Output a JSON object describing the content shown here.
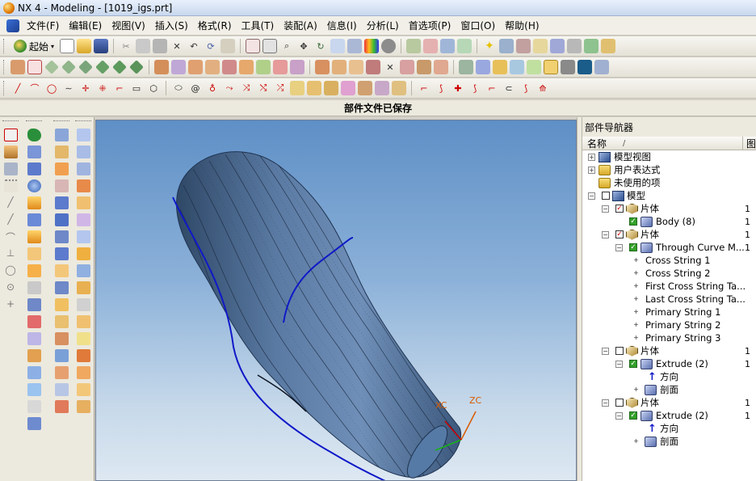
{
  "window": {
    "title": "NX 4 - Modeling - [1019_igs.prt]"
  },
  "menu": {
    "items": [
      "文件(F)",
      "编辑(E)",
      "视图(V)",
      "插入(S)",
      "格式(R)",
      "工具(T)",
      "装配(A)",
      "信息(I)",
      "分析(L)",
      "首选项(P)",
      "窗口(O)",
      "帮助(H)"
    ]
  },
  "toolbar": {
    "start_label": "起始",
    "status_message": "部件文件已保存"
  },
  "navigator": {
    "title": "部件导航器",
    "columns": {
      "name": "名称",
      "sort_indicator": "/",
      "image": "图"
    },
    "rows": [
      {
        "label": "模型视图",
        "expander": "+",
        "icon": "model-view-icon",
        "count": ""
      },
      {
        "label": "用户表达式",
        "expander": "+",
        "icon": "folder-icon",
        "count": ""
      },
      {
        "label": "未使用的项",
        "expander": "",
        "icon": "folder-icon",
        "count": ""
      },
      {
        "label": "模型",
        "expander": "−",
        "icon": "model-icon",
        "count": ""
      },
      {
        "label": "片体",
        "expander": "−",
        "icon": "sheet-body-icon",
        "count": "1"
      },
      {
        "label": "Body (8)",
        "expander": "",
        "icon": "body-feature-icon",
        "count": "1"
      },
      {
        "label": "片体",
        "expander": "−",
        "icon": "sheet-body-icon",
        "count": "1"
      },
      {
        "label": "Through Curve M...",
        "expander": "−",
        "icon": "through-curve-icon",
        "count": "1"
      },
      {
        "label": "Cross String 1",
        "expander": "+",
        "icon": "",
        "count": ""
      },
      {
        "label": "Cross String 2",
        "expander": "+",
        "icon": "",
        "count": ""
      },
      {
        "label": "First Cross String Ta...",
        "expander": "+",
        "icon": "",
        "count": ""
      },
      {
        "label": "Last Cross String Ta...",
        "expander": "+",
        "icon": "",
        "count": ""
      },
      {
        "label": "Primary String 1",
        "expander": "+",
        "icon": "",
        "count": ""
      },
      {
        "label": "Primary String 2",
        "expander": "+",
        "icon": "",
        "count": ""
      },
      {
        "label": "Primary String 3",
        "expander": "+",
        "icon": "",
        "count": ""
      },
      {
        "label": "片体",
        "expander": "−",
        "icon": "sheet-body-icon",
        "count": "1"
      },
      {
        "label": "Extrude (2)",
        "expander": "−",
        "icon": "extrude-icon",
        "count": "1"
      },
      {
        "label": "方向",
        "expander": "",
        "icon": "direction-arrow-icon",
        "count": ""
      },
      {
        "label": "剖面",
        "expander": "+",
        "icon": "section-icon",
        "count": ""
      },
      {
        "label": "片体",
        "expander": "−",
        "icon": "sheet-body-icon",
        "count": "1"
      },
      {
        "label": "Extrude (2)",
        "expander": "−",
        "icon": "extrude-icon",
        "count": "1"
      },
      {
        "label": "方向",
        "expander": "",
        "icon": "direction-arrow-icon",
        "count": ""
      },
      {
        "label": "剖面",
        "expander": "+",
        "icon": "section-icon",
        "count": ""
      }
    ]
  },
  "viewport": {
    "axis_labels": {
      "xc": "XC",
      "zc": "ZC"
    }
  },
  "colors": {
    "viewport_top": "#5e8fc6",
    "viewport_bottom": "#dde8f2",
    "model_surface": "#4f6e96",
    "guide_curve": "#1019c8",
    "checkbox_green": "#34a02a",
    "checkbox_red": "#d00000"
  }
}
